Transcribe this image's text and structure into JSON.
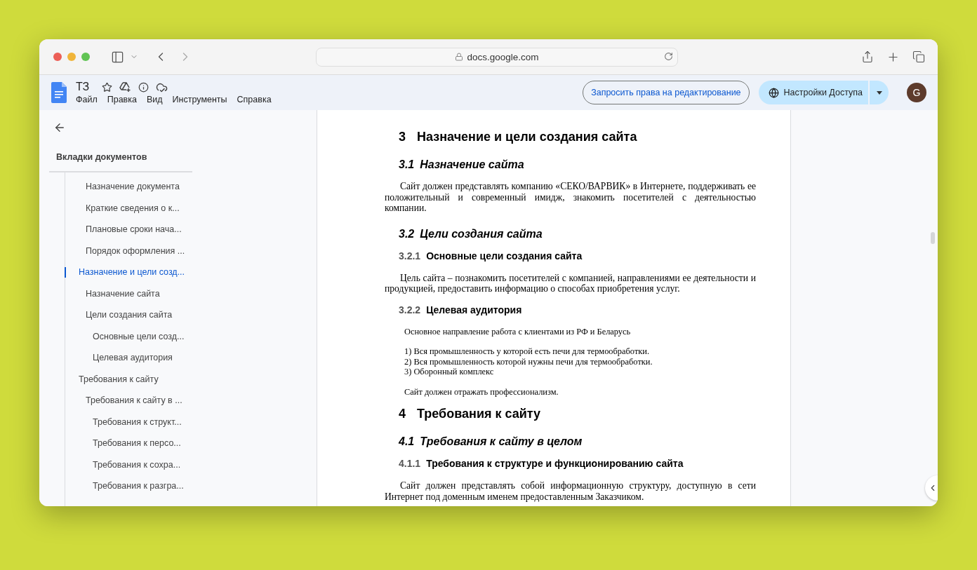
{
  "browser": {
    "url": "docs.google.com"
  },
  "doc": {
    "title": "ТЗ",
    "menu": [
      "Файл",
      "Правка",
      "Вид",
      "Инструменты",
      "Справка"
    ],
    "request_button": "Запросить права на редактирование",
    "share_button": "Настройки Доступа",
    "avatar": "G"
  },
  "sidebar": {
    "heading": "Вкладки документов",
    "outline": [
      {
        "children": [
          {
            "label": "Назначение документа",
            "selected": false
          },
          {
            "label": "Краткие сведения о к...",
            "selected": false
          },
          {
            "label": "Плановые сроки нача...",
            "selected": false
          },
          {
            "label": "Порядок оформления ...",
            "selected": false
          }
        ]
      },
      {
        "label": "Назначение и цели созд...",
        "selected": true,
        "children": [
          {
            "label": "Назначение сайта",
            "selected": false
          },
          {
            "label": "Цели создания сайта",
            "selected": false,
            "children": [
              {
                "label": "Основные цели созд...",
                "selected": false
              },
              {
                "label": "Целевая аудитория",
                "selected": false
              }
            ]
          }
        ]
      },
      {
        "label": "Требования к сайту",
        "selected": false,
        "children": [
          {
            "label": "Требования к сайту в ...",
            "selected": false,
            "children": [
              {
                "label": "Требования к структ...",
                "selected": false
              },
              {
                "label": "Требования к персо...",
                "selected": false
              },
              {
                "label": "Требования к сохра...",
                "selected": false
              },
              {
                "label": "Требования к разгра...",
                "selected": false
              }
            ]
          }
        ]
      }
    ]
  },
  "document": [
    {
      "kind": "h1",
      "number": "3",
      "title": "Назначение и цели создания сайта"
    },
    {
      "kind": "h2",
      "number": "3.1",
      "title": "Назначение сайта"
    },
    {
      "kind": "para",
      "text": "Сайт должен представлять компанию «СЕКО/ВАРВИК» в Интернете, поддерживать ее положительный и современный имидж, знакомить посетителей с деятельностью компании."
    },
    {
      "kind": "h2",
      "number": "3.2",
      "title": "Цели создания сайта"
    },
    {
      "kind": "h3",
      "number": "3.2.1",
      "title": "Основные цели создания сайта"
    },
    {
      "kind": "para",
      "text": "Цель сайта – познакомить посетителей с компанией, направлениями ее деятельности и продукцией, предоставить информацию о способах приобретения услуг."
    },
    {
      "kind": "h3",
      "number": "3.2.2",
      "title": "Целевая аудитория"
    },
    {
      "kind": "note",
      "text": "Основное направление работа с клиентами из РФ и Беларусь"
    },
    {
      "kind": "numbered",
      "lines": [
        "1) Вся промышленность у которой есть печи для термообработки.",
        "2) Вся промышленность которой нужны печи для термообработки.",
        "3) Оборонный комплекс"
      ]
    },
    {
      "kind": "note",
      "text": "Сайт должен отражать профессионализм."
    },
    {
      "kind": "h1",
      "number": "4",
      "title": "Требования к сайту"
    },
    {
      "kind": "h2",
      "number": "4.1",
      "title": "Требования к сайту в целом"
    },
    {
      "kind": "h3",
      "number": "4.1.1",
      "title": "Требования к структуре и функционированию сайта"
    },
    {
      "kind": "para",
      "text": "Сайт должен представлять собой информационную структуру, доступную в сети Интернет под доменным именем предоставленным Заказчиком."
    }
  ]
}
